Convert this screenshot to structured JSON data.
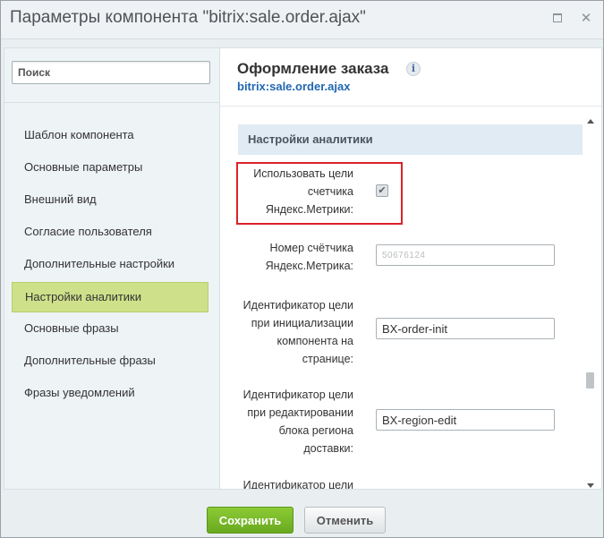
{
  "window": {
    "title": "Параметры компонента \"bitrix:sale.order.ajax\""
  },
  "sidebar": {
    "search_placeholder": "Поиск",
    "items": [
      {
        "label": "Шаблон компонента"
      },
      {
        "label": "Основные параметры"
      },
      {
        "label": "Внешний вид"
      },
      {
        "label": "Согласие пользователя"
      },
      {
        "label": "Дополнительные настройки"
      },
      {
        "label": "Настройки аналитики",
        "active": true
      },
      {
        "label": "Основные фразы"
      },
      {
        "label": "Дополнительные фразы"
      },
      {
        "label": "Фразы уведомлений"
      }
    ]
  },
  "content": {
    "title": "Оформление заказа",
    "subtitle": "bitrix:sale.order.ajax",
    "info_icon": "i",
    "group_title": "Настройки аналитики",
    "rows": [
      {
        "label_lines": [
          "Использовать цели",
          "счетчика",
          "Яндекс.Метрики:"
        ],
        "type": "checkbox",
        "checked": true
      },
      {
        "label_lines": [
          "Номер счётчика",
          "Яндекс.Метрика:"
        ],
        "type": "text",
        "value": "50676124"
      },
      {
        "label_lines": [
          "Идентификатор цели",
          "при инициализации",
          "компонента на",
          "странице:"
        ],
        "type": "text",
        "value": "BX-order-init"
      },
      {
        "label_lines": [
          "Идентификатор цели",
          "при редактировании",
          "блока региона",
          "доставки:"
        ],
        "type": "text",
        "value": "BX-region-edit"
      },
      {
        "label_lines": [
          "Идентификатор цели"
        ],
        "type": "text",
        "value": ""
      }
    ]
  },
  "footer": {
    "save_label": "Сохранить",
    "cancel_label": "Отменить"
  },
  "colors": {
    "active_nav": "#cfe08a",
    "highlight": "#d9222a",
    "link": "#2067b0",
    "save_button": "#77b52a"
  }
}
